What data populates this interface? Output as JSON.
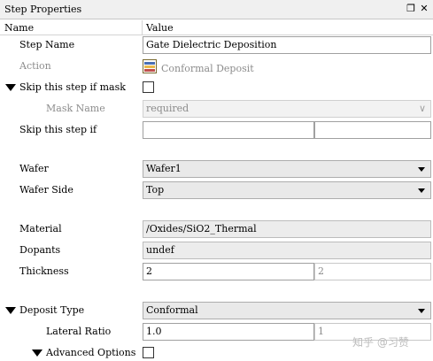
{
  "panel": {
    "title": "Step Properties",
    "float_icon": "❐",
    "close_icon": "✕"
  },
  "header": {
    "name_col": "Name",
    "value_col": "Value"
  },
  "rows": {
    "step_name": {
      "label": "Step Name",
      "value": "Gate Dielectric Deposition"
    },
    "action": {
      "label": "Action",
      "value": "Conformal Deposit",
      "icon": "conformal-deposit-icon"
    },
    "skip_if_mask": {
      "label": "Skip this step if mask",
      "checked": false
    },
    "mask_name": {
      "label": "Mask Name",
      "value": "required"
    },
    "skip_if": {
      "label": "Skip this step if",
      "value_a": "",
      "value_b": ""
    },
    "wafer": {
      "label": "Wafer",
      "value": "Wafer1"
    },
    "wafer_side": {
      "label": "Wafer Side",
      "value": "Top"
    },
    "material": {
      "label": "Material",
      "value": "/Oxides/SiO2_Thermal"
    },
    "dopants": {
      "label": "Dopants",
      "value": "undef"
    },
    "thickness": {
      "label": "Thickness",
      "value": "2",
      "evaluated": "2"
    },
    "deposit_type": {
      "label": "Deposit Type",
      "value": "Conformal"
    },
    "lateral_ratio": {
      "label": "Lateral Ratio",
      "value": "1.0",
      "evaluated": "1"
    },
    "advanced_options": {
      "label": "Advanced Options",
      "checked": false
    }
  },
  "watermark": "知乎 @习赞",
  "colors": {
    "icon_stripe_1": "#4a6fb5",
    "icon_stripe_2": "#e8b84a",
    "icon_stripe_3": "#c0504d"
  }
}
